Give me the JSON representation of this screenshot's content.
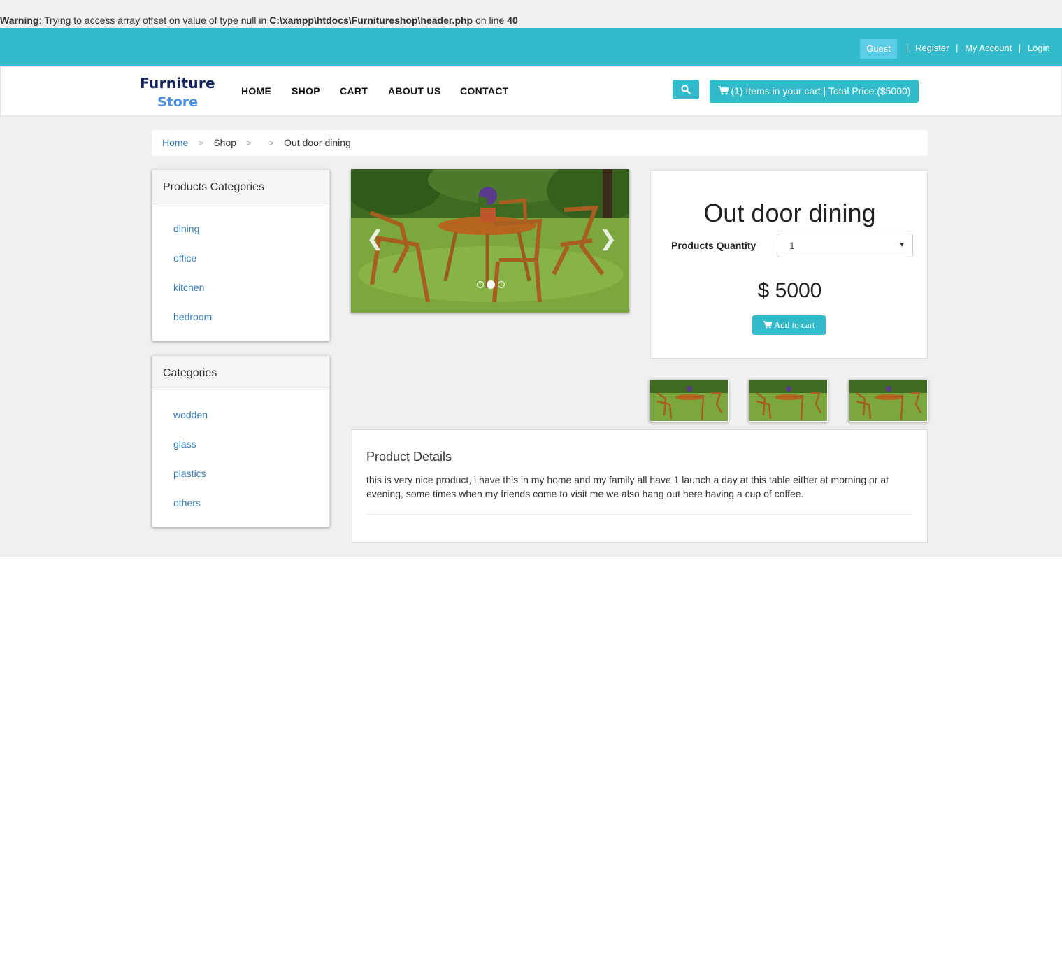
{
  "warning": {
    "label": "Warning",
    "text": ": Trying to access array offset on value of type null in ",
    "path": "C:\\xampp\\htdocs\\Furnitureshop\\header.php",
    "on_line": " on line ",
    "line": "40"
  },
  "topbar": {
    "guest": "Guest",
    "register": "Register",
    "account": "My Account",
    "login": "Login",
    "separator": "|"
  },
  "brand": {
    "line1": "Furniture",
    "line2": "Store"
  },
  "nav": {
    "home": "HOME",
    "shop": "SHOP",
    "cart": "CART",
    "about": "ABOUT US",
    "contact": "CONTACT"
  },
  "cart_button": {
    "label": "(1) Items in your cart | Total Price:($5000)"
  },
  "breadcrumb": {
    "home": "Home",
    "shop": "Shop",
    "current": "Out door dining",
    "sep": ">"
  },
  "product_categories": {
    "title": "Products Categories",
    "items": [
      "dining",
      "office",
      "kitchen",
      "bedroom"
    ]
  },
  "categories": {
    "title": "Categories",
    "items": [
      "wodden",
      "glass",
      "plastics",
      "others"
    ]
  },
  "product": {
    "title": "Out door dining",
    "quantity_label": "Products Quantity",
    "quantity_value": "1",
    "price": "$ 5000",
    "add_to_cart": "Add to cart"
  },
  "details": {
    "title": "Product Details",
    "text": "this is very nice product, i have this in my home and my family all have 1 launch a day at this table either at morning or at evening, some times when my friends come to visit me we also hang out here having a cup of coffee."
  },
  "colors": {
    "accent": "#33bbcc",
    "link": "#337ab7",
    "logo_dark": "#14235e",
    "logo_light": "#4a90e2"
  }
}
